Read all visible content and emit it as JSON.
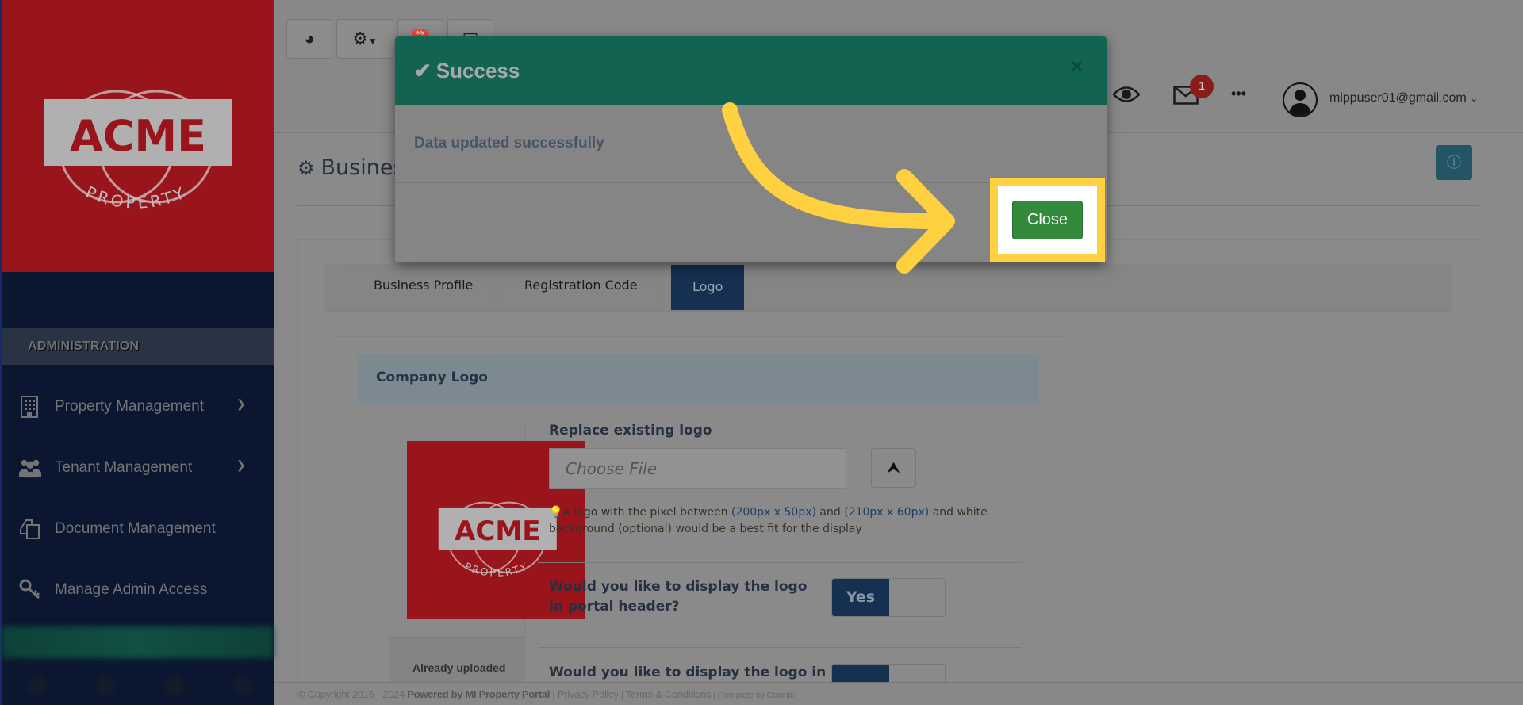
{
  "brand": {
    "name": "ACME",
    "tagline": "PROPERTY"
  },
  "sidebar": {
    "section": "ADMINISTRATION",
    "items": [
      {
        "label": "Property Management",
        "icon": "building-icon",
        "expandable": true
      },
      {
        "label": "Tenant Management",
        "icon": "users-icon",
        "expandable": true
      },
      {
        "label": "Document Management",
        "icon": "documents-icon",
        "expandable": false
      },
      {
        "label": "Manage Admin Access",
        "icon": "key-icon",
        "expandable": false
      }
    ]
  },
  "topbar": {
    "buttons": [
      "dashboard-icon",
      "settings-dropdown-icon",
      "calendar-icon",
      "calculator-icon"
    ],
    "notification_count": "1",
    "user_email": "mippuser01@gmail.com",
    "chevron": "⌄"
  },
  "page": {
    "title": "Business Settings",
    "tabs": [
      {
        "label": "Business Profile",
        "active": false
      },
      {
        "label": "Registration Code",
        "active": false
      },
      {
        "label": "Logo",
        "active": true
      }
    ],
    "card_title": "Company Logo",
    "replace_label": "Replace existing logo",
    "file_placeholder": "Choose File",
    "hint_pre": "A logo with the pixel between ",
    "hint_px1": "(200px x 50px)",
    "hint_mid": " and ",
    "hint_px2": "(210px x 60px)",
    "hint_post": " and white background (optional) would be a best fit for the display",
    "question1": "Would you like to display the logo in portal header?",
    "toggle1": "Yes",
    "question2": "Would you like to display the logo in",
    "already_uploaded": "Already uploaded"
  },
  "footer": {
    "copyright": "© Copyright 2016 - 2024 ",
    "powered": "Powered by MI Property Portal",
    "sep": " | ",
    "privacy": "Privacy Policy",
    "terms": "Terms & Conditions",
    "template": " | (Template by Colorlib)"
  },
  "modal": {
    "title": "Success",
    "message": "Data updated successfully",
    "close_label": "Close",
    "close_x": "×"
  },
  "colors": {
    "modal_header": "#136352",
    "close_button": "#338a3a",
    "highlight": "#ffd040",
    "brand_red": "#9a141c"
  }
}
